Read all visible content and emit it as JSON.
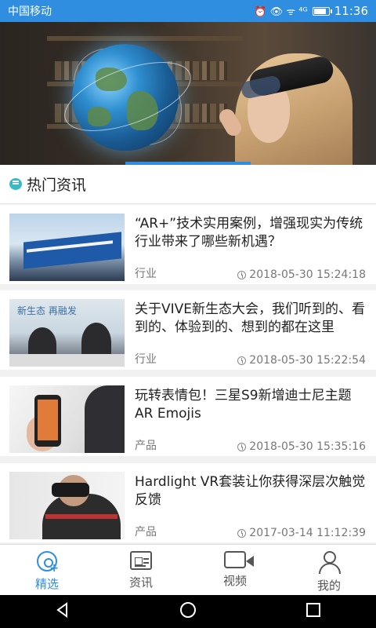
{
  "status_bar": {
    "carrier": "中国移动",
    "icons": "⏰ 👁 ᯤ ⁴ᴳ",
    "battery_level": 0.85,
    "time": "11:36"
  },
  "banner": {
    "active_index": 1
  },
  "section": {
    "title": "热门资讯"
  },
  "news": [
    {
      "title": "“AR+”技术实用案例，增强现实为传统行业带来了哪些新机遇？",
      "tag": "行业",
      "time": "2018-05-30 15:24:18"
    },
    {
      "title": "关于VIVE新生态大会，我们听到的、看到的、体验到的、想到的都在这里",
      "tag": "行业",
      "time": "2018-05-30 15:22:54",
      "thumb_text": "新生态 再融发"
    },
    {
      "title": "玩转表情包！三星S9新增迪士尼主题AR Emojis",
      "tag": "产品",
      "time": "2018-05-30 15:35:16"
    },
    {
      "title": "Hardlight VR套装让你获得深层次触觉反馈",
      "tag": "产品",
      "time": "2017-03-14 11:12:39"
    }
  ],
  "bottom_nav": [
    {
      "label": "精选",
      "icon": "featured-icon",
      "active": true
    },
    {
      "label": "资讯",
      "icon": "news-icon",
      "active": false
    },
    {
      "label": "视频",
      "icon": "video-icon",
      "active": false
    },
    {
      "label": "我的",
      "icon": "user-icon",
      "active": false
    }
  ],
  "colors": {
    "accent": "#2f8ee0",
    "section_icon": "#37b9c9"
  }
}
